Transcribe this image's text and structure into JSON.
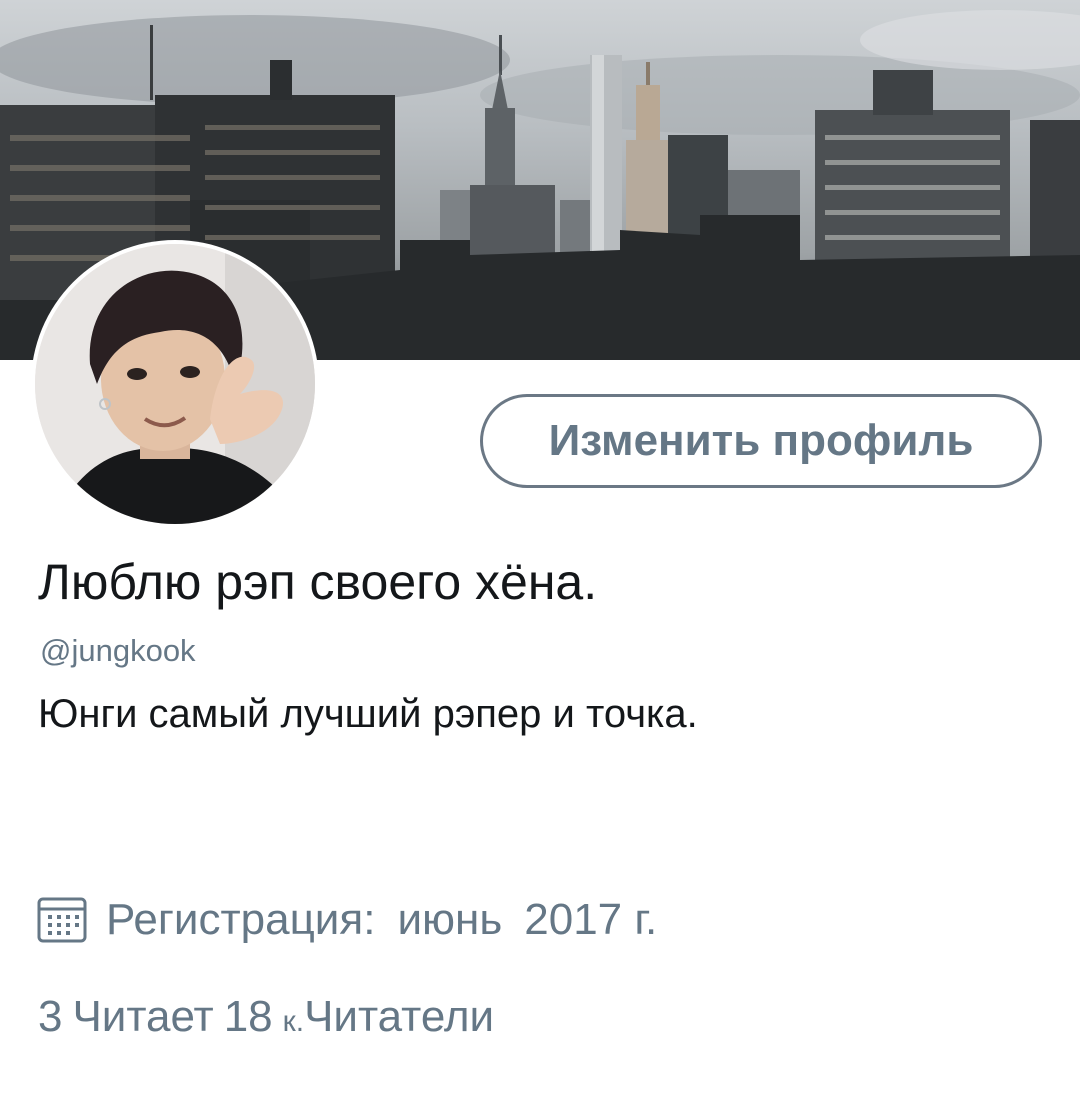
{
  "profile": {
    "edit_button_label": "Изменить профиль",
    "display_name": "Люблю рэп своего хёна.",
    "handle": "@jungkook",
    "bio": "Юнги самый лучший рэпер и точка.",
    "joined_label": "Регистрация:",
    "joined_month": "июнь",
    "joined_year": "2017 г.",
    "following_count": "3",
    "following_label": "Читает",
    "followers_count": "18",
    "followers_suffix": "к.",
    "followers_label": "Читатели"
  },
  "icons": {
    "joined": "calendar-icon"
  },
  "colors": {
    "text_primary": "#14171a",
    "text_secondary": "#657786",
    "button_border": "#6b7885"
  }
}
